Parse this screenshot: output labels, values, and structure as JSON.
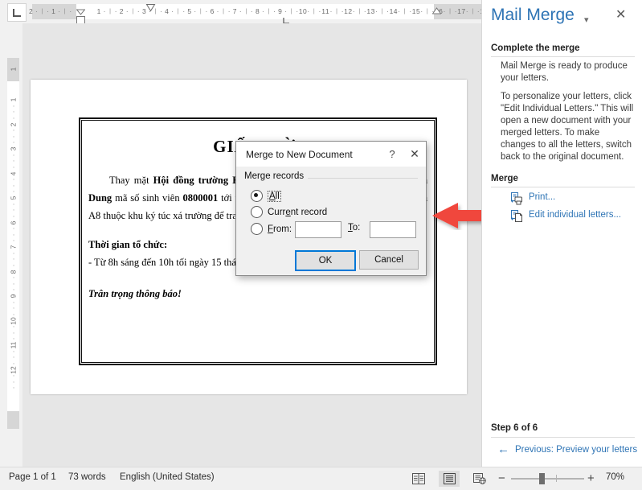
{
  "ruler": {
    "horizontal_ticks": [
      "2",
      "1",
      "1",
      "2",
      "3",
      "4",
      "5",
      "6",
      "7",
      "8",
      "9",
      "10",
      "11",
      "12",
      "13",
      "14",
      "15",
      "16",
      "17",
      "18"
    ],
    "vertical_ticks": [
      "1",
      "1",
      "2",
      "3",
      "4",
      "5",
      "6",
      "7",
      "8",
      "9",
      "10",
      "11",
      "12"
    ],
    "tab_stop_label": "left-tab-stop"
  },
  "document": {
    "title": "GIẤY MỜI",
    "body_paragraph": "Thay mặt <b>Hội đồng trường Kinh tế</b> xin trân trọng kính mời <b>Lê Thị Kim Dung</b> mã số sinh viên <b>0800001</b> tới tham dự buổi họp mặt thường niên tại khu nhà A8 thuộc khu ký túc xá trường để trao đổi về các vấn đề sinh viên.",
    "section_heading": "Thời gian tổ chức:",
    "time_line": "- Từ 8h sáng đến 10h tối ngày 15 tháng 03 năm 2019.",
    "closing": "Trân trọng thông báo!"
  },
  "dialog": {
    "title": "Merge to New Document",
    "help_glyph": "?",
    "close_glyph": "✕",
    "group_label": "Merge records",
    "options": [
      {
        "label": "All",
        "checked": true,
        "accesskey_index": 0
      },
      {
        "label": "Current record",
        "checked": false
      },
      {
        "label": "From:",
        "checked": false
      }
    ],
    "from_value": "",
    "to_label": "To:",
    "to_value": "",
    "buttons": {
      "ok": "OK",
      "cancel": "Cancel"
    }
  },
  "pane": {
    "title": "Mail Merge",
    "caret_glyph": "▾",
    "close_glyph": "✕",
    "section1_heading": "Complete the merge",
    "paragraph1": "Mail Merge is ready to produce your letters.",
    "paragraph2": "To personalize your letters, click \"Edit Individual Letters.\" This will open a new document with your merged letters. To make changes to all the letters, switch back to the original document.",
    "section2_heading": "Merge",
    "links": [
      {
        "label": "Print...",
        "icon": "print-document-icon"
      },
      {
        "label": "Edit individual letters...",
        "icon": "edit-document-icon"
      }
    ],
    "step_label": "Step 6 of 6",
    "previous_link": "Previous: Preview your letters",
    "previous_arrow_glyph": "←",
    "accent_color": "#2e74b5"
  },
  "statusbar": {
    "page_info": "Page 1 of 1",
    "word_count": "73 words",
    "language": "English (United States)",
    "views": [
      {
        "name": "read-mode-view",
        "active": false
      },
      {
        "name": "print-layout-view",
        "active": true
      },
      {
        "name": "web-layout-view",
        "active": false
      }
    ],
    "zoom_minus": "−",
    "zoom_plus": "+",
    "zoom_value": "70%"
  },
  "annotation": {
    "arrow_color": "#f0463c",
    "arrow_direction": "left"
  }
}
